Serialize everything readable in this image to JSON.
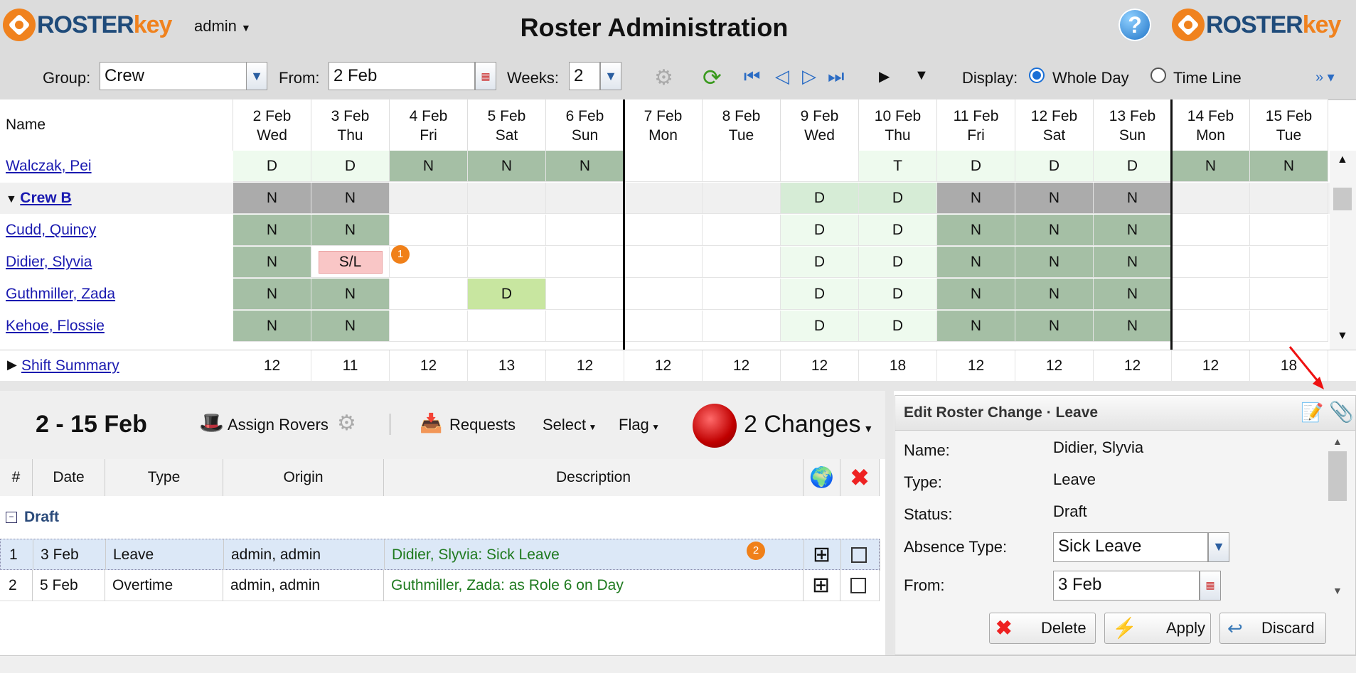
{
  "app": {
    "brand_a": "ROSTER",
    "brand_b": "key",
    "user": "admin",
    "title": "Roster Administration",
    "help": "?"
  },
  "toolbar": {
    "group_label": "Group:",
    "group_value": "Crew",
    "from_label": "From:",
    "from_value": "2 Feb",
    "weeks_label": "Weeks:",
    "weeks_value": "2",
    "display_label": "Display:",
    "opt_whole": "Whole Day",
    "opt_timeline": "Time Line"
  },
  "grid": {
    "name_header": "Name",
    "days": [
      {
        "d": "2 Feb",
        "w": "Wed"
      },
      {
        "d": "3 Feb",
        "w": "Thu"
      },
      {
        "d": "4 Feb",
        "w": "Fri"
      },
      {
        "d": "5 Feb",
        "w": "Sat"
      },
      {
        "d": "6 Feb",
        "w": "Sun"
      },
      {
        "d": "7 Feb",
        "w": "Mon"
      },
      {
        "d": "8 Feb",
        "w": "Tue"
      },
      {
        "d": "9 Feb",
        "w": "Wed"
      },
      {
        "d": "10 Feb",
        "w": "Thu"
      },
      {
        "d": "11 Feb",
        "w": "Fri"
      },
      {
        "d": "12 Feb",
        "w": "Sat"
      },
      {
        "d": "13 Feb",
        "w": "Sun"
      },
      {
        "d": "14 Feb",
        "w": "Mon"
      },
      {
        "d": "15 Feb",
        "w": "Tue"
      }
    ],
    "rows": [
      {
        "name": "Walczak, Pei",
        "cells": [
          [
            "D",
            "D"
          ],
          [
            "D",
            "D"
          ],
          [
            "N",
            "N"
          ],
          [
            "N",
            "N"
          ],
          [
            "N",
            "N"
          ],
          [
            "",
            ""
          ],
          [
            "",
            ""
          ],
          [
            "",
            ""
          ],
          [
            "T",
            "T"
          ],
          [
            "D",
            "D"
          ],
          [
            "D",
            "D"
          ],
          [
            "D",
            "D"
          ],
          [
            "N",
            "N"
          ],
          [
            "N",
            "N"
          ]
        ]
      },
      {
        "name": "Crew B",
        "group": true,
        "cells": [
          [
            "N",
            "G"
          ],
          [
            "N",
            "G"
          ],
          [
            "",
            ""
          ],
          [
            "",
            ""
          ],
          [
            "",
            ""
          ],
          [
            "",
            ""
          ],
          [
            "",
            ""
          ],
          [
            "D",
            "Dg"
          ],
          [
            "D",
            "Dg"
          ],
          [
            "N",
            "G"
          ],
          [
            "N",
            "G"
          ],
          [
            "N",
            "G"
          ],
          [
            "",
            ""
          ],
          [
            "",
            ""
          ]
        ]
      },
      {
        "name": "Cudd, Quincy",
        "cells": [
          [
            "N",
            "N"
          ],
          [
            "N",
            "N"
          ],
          [
            "",
            ""
          ],
          [
            "",
            ""
          ],
          [
            "",
            ""
          ],
          [
            "",
            ""
          ],
          [
            "",
            ""
          ],
          [
            "D",
            "D"
          ],
          [
            "D",
            "D"
          ],
          [
            "N",
            "N"
          ],
          [
            "N",
            "N"
          ],
          [
            "N",
            "N"
          ],
          [
            "",
            ""
          ],
          [
            "",
            ""
          ]
        ]
      },
      {
        "name": "Didier, Slyvia",
        "cells": [
          [
            "N",
            "N"
          ],
          [
            "S/L",
            "SL"
          ],
          [
            "",
            ""
          ],
          [
            "",
            ""
          ],
          [
            "",
            ""
          ],
          [
            "",
            ""
          ],
          [
            "",
            ""
          ],
          [
            "D",
            "D"
          ],
          [
            "D",
            "D"
          ],
          [
            "N",
            "N"
          ],
          [
            "N",
            "N"
          ],
          [
            "N",
            "N"
          ],
          [
            "",
            ""
          ],
          [
            "",
            ""
          ]
        ]
      },
      {
        "name": "Guthmiller, Zada",
        "cells": [
          [
            "N",
            "N"
          ],
          [
            "N",
            "N"
          ],
          [
            "",
            ""
          ],
          [
            "D",
            "DL"
          ],
          [
            "",
            ""
          ],
          [
            "",
            ""
          ],
          [
            "",
            ""
          ],
          [
            "D",
            "D"
          ],
          [
            "D",
            "D"
          ],
          [
            "N",
            "N"
          ],
          [
            "N",
            "N"
          ],
          [
            "N",
            "N"
          ],
          [
            "",
            ""
          ],
          [
            "",
            ""
          ]
        ]
      },
      {
        "name": "Kehoe, Flossie",
        "cells": [
          [
            "N",
            "N"
          ],
          [
            "N",
            "N"
          ],
          [
            "",
            ""
          ],
          [
            "",
            ""
          ],
          [
            "",
            ""
          ],
          [
            "",
            ""
          ],
          [
            "",
            ""
          ],
          [
            "D",
            "D"
          ],
          [
            "D",
            "D"
          ],
          [
            "N",
            "N"
          ],
          [
            "N",
            "N"
          ],
          [
            "N",
            "N"
          ],
          [
            "",
            ""
          ],
          [
            "",
            ""
          ]
        ]
      }
    ],
    "summary_label": "Shift Summary",
    "summary": [
      "12",
      "11",
      "12",
      "13",
      "12",
      "12",
      "12",
      "12",
      "18",
      "12",
      "12",
      "12",
      "12",
      "18"
    ]
  },
  "changes": {
    "range": "2 - 15 Feb",
    "assign": "Assign Rovers",
    "requests": "Requests",
    "select": "Select",
    "flag": "Flag",
    "count": "2 Changes",
    "cols": [
      "#",
      "Date",
      "Type",
      "Origin",
      "Description"
    ],
    "group": "Draft",
    "rows": [
      {
        "n": "1",
        "date": "3 Feb",
        "type": "Leave",
        "origin": "admin, admin",
        "desc": "Didier, Slyvia: Sick Leave"
      },
      {
        "n": "2",
        "date": "5 Feb",
        "type": "Overtime",
        "origin": "admin, admin",
        "desc": "Guthmiller, Zada: as Role 6 on Day"
      }
    ]
  },
  "edit": {
    "title": "Edit Roster Change · Leave",
    "name_label": "Name:",
    "name": "Didier, Slyvia",
    "type_label": "Type:",
    "type": "Leave",
    "status_label": "Status:",
    "status": "Draft",
    "absence_label": "Absence Type:",
    "absence": "Sick Leave",
    "from_label": "From:",
    "from": "3 Feb",
    "delete": "Delete",
    "apply": "Apply",
    "discard": "Discard"
  },
  "badges": {
    "one": "1",
    "two": "2"
  }
}
